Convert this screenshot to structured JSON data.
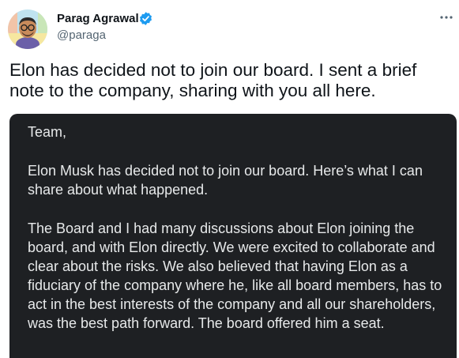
{
  "author": {
    "name": "Parag Agrawal",
    "handle": "@paraga"
  },
  "icons": {
    "verified": "verified-badge-icon",
    "more": "more-options-icon",
    "avatar": "cartoon-avatar-image"
  },
  "colors": {
    "verified_blue": "#1d9bf0",
    "note_background": "#1e2023",
    "handle_gray": "#536471"
  },
  "tweet": {
    "text": "Elon has decided not to join our board. I sent a brief\nnote to the company, sharing with you all here."
  },
  "note": {
    "paragraphs": [
      "Team,",
      "Elon Musk has decided not to join our board. Here’s what I can share about what happened.",
      "The Board and I had many discussions about Elon joining the board, and with Elon directly. We were excited to collaborate and clear about the risks. We also believed that having Elon as a fiduciary of the company where he, like all board members, has to act in the best interests of the company and all our shareholders, was the best path forward. The board offered him a seat."
    ]
  }
}
